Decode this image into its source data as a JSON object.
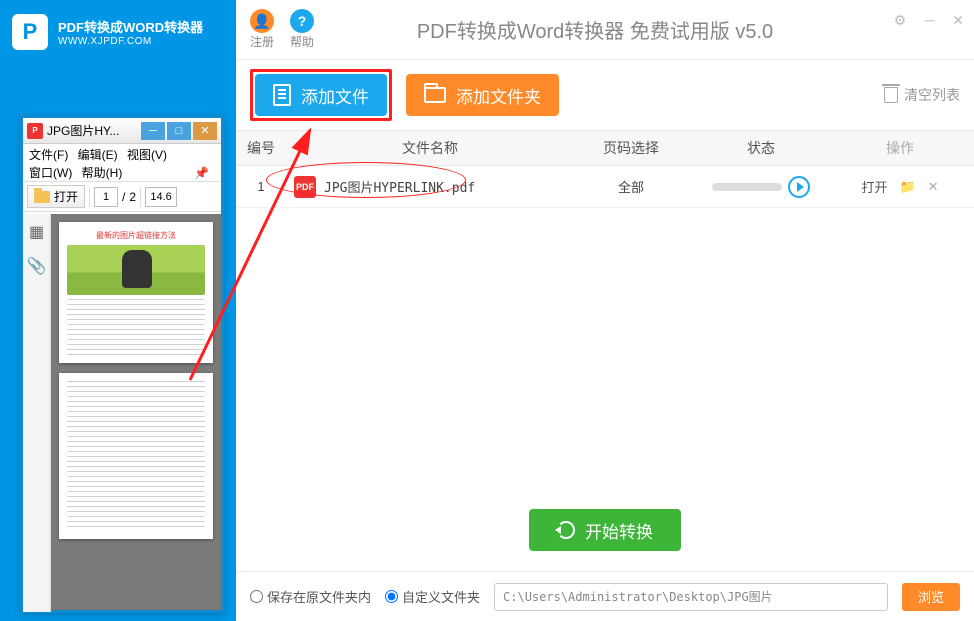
{
  "logo": {
    "mark": "P",
    "title": "PDF转换成WORD转换器",
    "url": "WWW.XJPDF.COM"
  },
  "pdf_viewer": {
    "title": "JPG图片HY...",
    "menus": {
      "file": "文件(F)",
      "edit": "编辑(E)",
      "view": "视图(V)",
      "window": "窗口(W)",
      "help": "帮助(H)"
    },
    "toolbar": {
      "open": "打开",
      "page_current": "1",
      "page_sep": "/",
      "page_total": "2",
      "zoom": "14.6"
    },
    "thumb_title": "最新的图片超链接方法"
  },
  "topbar": {
    "register": "注册",
    "help": "帮助",
    "app_title": "PDF转换成Word转换器 免费试用版 v5.0"
  },
  "actionbar": {
    "add_file": "添加文件",
    "add_folder": "添加文件夹",
    "clear_list": "清空列表"
  },
  "table": {
    "headers": {
      "num": "编号",
      "name": "文件名称",
      "pages": "页码选择",
      "status": "状态",
      "ops": "操作"
    },
    "rows": [
      {
        "num": "1",
        "badge": "PDF",
        "name": "JPG图片HYPERLINK.pdf",
        "pages": "全部",
        "open": "打开"
      }
    ]
  },
  "start_button": "开始转换",
  "save": {
    "opt_same": "保存在原文件夹内",
    "opt_custom": "自定义文件夹",
    "path": "C:\\Users\\Administrator\\Desktop\\JPG图片",
    "browse": "浏览"
  }
}
